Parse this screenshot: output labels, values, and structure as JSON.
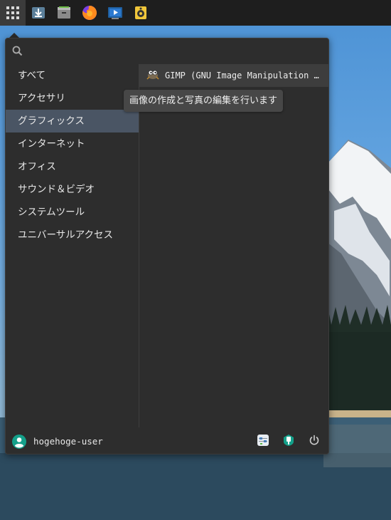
{
  "panel": {
    "launchers": [
      {
        "icon": "apps-grid-icon",
        "active": true
      },
      {
        "icon": "downloader-icon"
      },
      {
        "icon": "archive-manager-icon"
      },
      {
        "icon": "firefox-icon"
      },
      {
        "icon": "screen-recorder-icon"
      },
      {
        "icon": "rhythmbox-icon"
      }
    ]
  },
  "menu": {
    "search": {
      "value": "",
      "placeholder": ""
    },
    "categories": [
      {
        "label": "すべて"
      },
      {
        "label": "アクセサリ"
      },
      {
        "label": "グラフィックス",
        "selected": true
      },
      {
        "label": "インターネット"
      },
      {
        "label": "オフィス"
      },
      {
        "label": "サウンド＆ビデオ"
      },
      {
        "label": "システムツール"
      },
      {
        "label": "ユニバーサルアクセス"
      }
    ],
    "apps": [
      {
        "label": "GIMP (GNU Image Manipulation …",
        "icon": "gimp-icon",
        "tooltip": "画像の作成と写真の編集を行います"
      }
    ],
    "footer": {
      "username": "hogehoge-user",
      "avatar_icon": "user-avatar-icon",
      "actions": [
        {
          "icon": "system-settings-icon"
        },
        {
          "icon": "software-center-icon"
        },
        {
          "icon": "power-icon"
        }
      ]
    }
  },
  "colors": {
    "panel_bg": "#1e1e1e",
    "menu_bg": "#2d2d2d",
    "selected_bg": "#4a5564",
    "avatar": "#14a08a"
  }
}
